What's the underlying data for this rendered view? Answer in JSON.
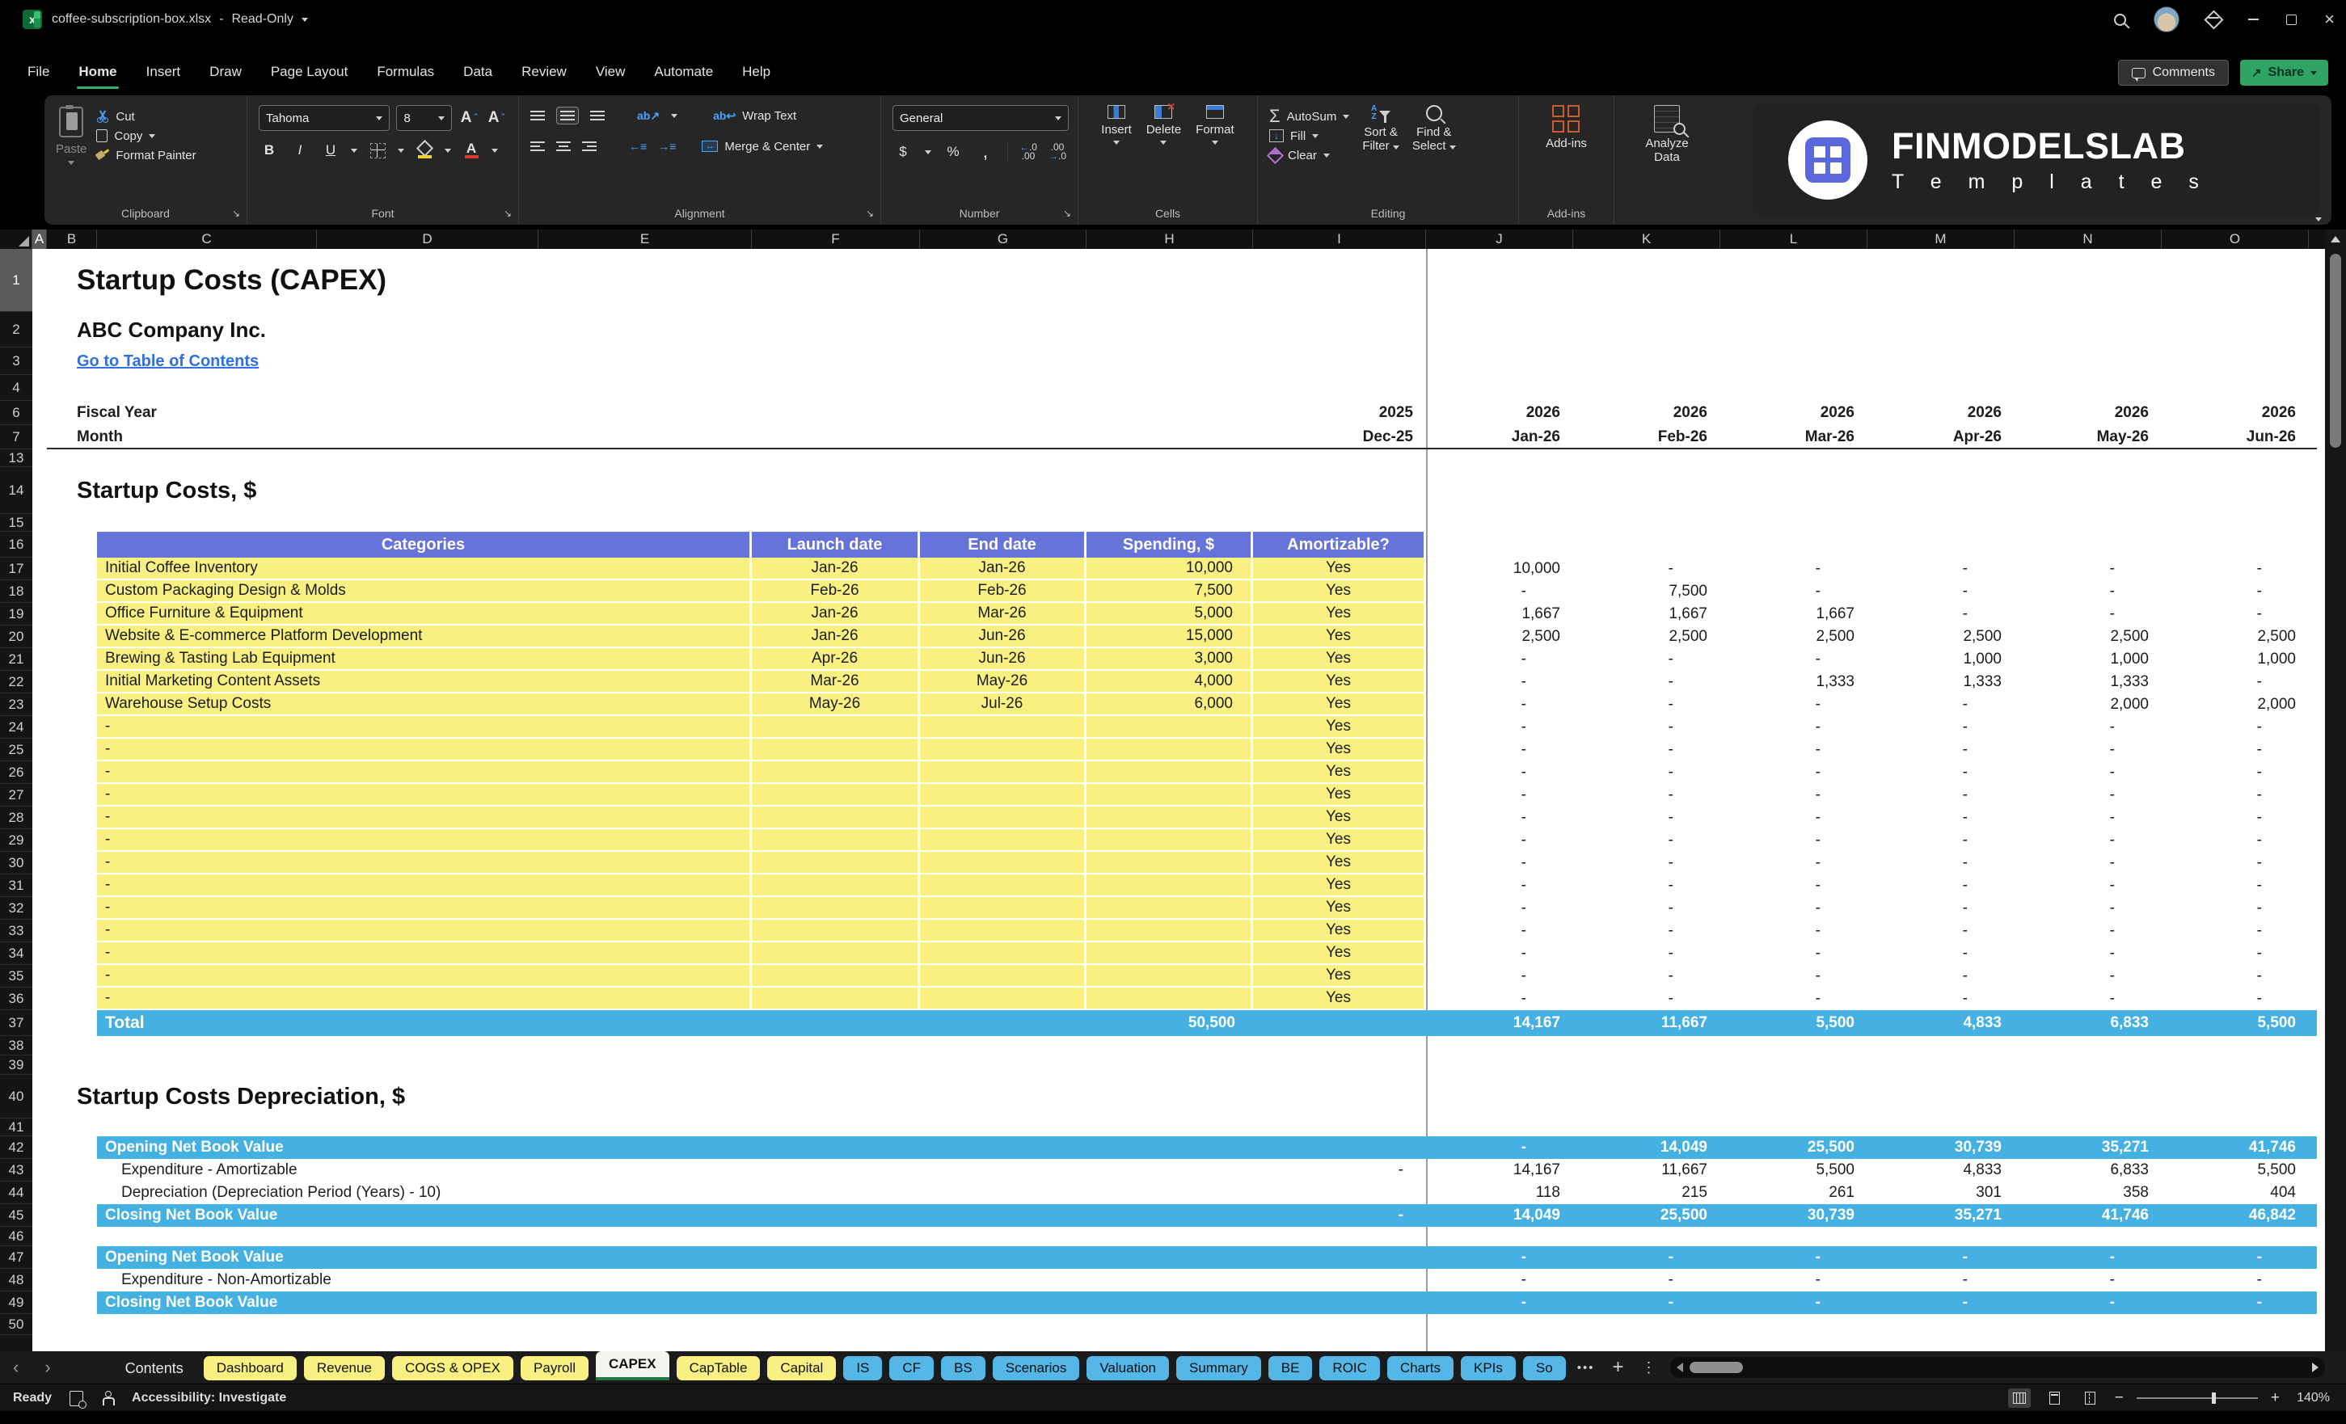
{
  "titlebar": {
    "filename": "coffee-subscription-box.xlsx",
    "separator": "-",
    "mode": "Read-Only"
  },
  "menu": {
    "items": [
      "File",
      "Home",
      "Insert",
      "Draw",
      "Page Layout",
      "Formulas",
      "Data",
      "Review",
      "View",
      "Automate",
      "Help"
    ],
    "active": "Home",
    "comments": "Comments",
    "share": "Share"
  },
  "ribbon": {
    "paste": "Paste",
    "cut": "Cut",
    "copy": "Copy",
    "format_painter": "Format Painter",
    "clipboard_group": "Clipboard",
    "font_name": "Tahoma",
    "font_size": "8",
    "font_group": "Font",
    "wrap_text": "Wrap Text",
    "merge_center": "Merge & Center",
    "alignment_group": "Alignment",
    "number_format": "General",
    "number_group": "Number",
    "insert": "Insert",
    "delete": "Delete",
    "format": "Format",
    "cells_group": "Cells",
    "autosum": "AutoSum",
    "fill": "Fill",
    "clear": "Clear",
    "sort_l1": "Sort &",
    "sort_l2": "Filter",
    "find_l1": "Find &",
    "find_l2": "Select",
    "editing_group": "Editing",
    "addins": "Add-ins",
    "addins_group": "Add-ins",
    "analyze_l1": "Analyze",
    "analyze_l2": "Data",
    "brand": "FINMODELSLAB",
    "brand_sub": "T e m p l a t e s"
  },
  "grid": {
    "columns": [
      "A",
      "B",
      "C",
      "D",
      "E",
      "F",
      "G",
      "H",
      "I",
      "J",
      "K",
      "L",
      "M",
      "N",
      "O"
    ],
    "row_numbers": [
      1,
      2,
      3,
      4,
      6,
      7,
      13,
      14,
      15,
      16,
      17,
      18,
      19,
      20,
      21,
      22,
      23,
      24,
      25,
      26,
      27,
      28,
      29,
      30,
      31,
      32,
      33,
      34,
      35,
      36,
      37,
      38,
      39,
      40,
      41,
      42,
      43,
      44,
      45,
      46,
      47,
      48,
      49,
      50
    ],
    "title": "Startup Costs (CAPEX)",
    "company": "ABC Company Inc.",
    "link": "Go to Table of Contents",
    "fiscal": {
      "label": "Fiscal Year",
      "dec": "2025",
      "months": [
        "2026",
        "2026",
        "2026",
        "2026",
        "2026",
        "2026"
      ]
    },
    "month": {
      "label": "Month",
      "dec": "Dec-25",
      "months": [
        "Jan-26",
        "Feb-26",
        "Mar-26",
        "Apr-26",
        "May-26",
        "Jun-26"
      ]
    },
    "section1": "Startup Costs, $",
    "table": {
      "headers": [
        "Categories",
        "Launch date",
        "End date",
        "Spending, $",
        "Amortizable?"
      ],
      "rows": [
        {
          "category": "Initial Coffee Inventory",
          "launch": "Jan-26",
          "end": "Jan-26",
          "spending": "10,000",
          "amortizable": "Yes",
          "monthly": [
            "10,000",
            "-",
            "-",
            "-",
            "-",
            "-"
          ]
        },
        {
          "category": "Custom Packaging Design & Molds",
          "launch": "Feb-26",
          "end": "Feb-26",
          "spending": "7,500",
          "amortizable": "Yes",
          "monthly": [
            "-",
            "7,500",
            "-",
            "-",
            "-",
            "-"
          ]
        },
        {
          "category": "Office Furniture & Equipment",
          "launch": "Jan-26",
          "end": "Mar-26",
          "spending": "5,000",
          "amortizable": "Yes",
          "monthly": [
            "1,667",
            "1,667",
            "1,667",
            "-",
            "-",
            "-"
          ]
        },
        {
          "category": "Website & E-commerce Platform Development",
          "launch": "Jan-26",
          "end": "Jun-26",
          "spending": "15,000",
          "amortizable": "Yes",
          "monthly": [
            "2,500",
            "2,500",
            "2,500",
            "2,500",
            "2,500",
            "2,500"
          ]
        },
        {
          "category": "Brewing & Tasting Lab Equipment",
          "launch": "Apr-26",
          "end": "Jun-26",
          "spending": "3,000",
          "amortizable": "Yes",
          "monthly": [
            "-",
            "-",
            "-",
            "1,000",
            "1,000",
            "1,000"
          ]
        },
        {
          "category": "Initial Marketing Content Assets",
          "launch": "Mar-26",
          "end": "May-26",
          "spending": "4,000",
          "amortizable": "Yes",
          "monthly": [
            "-",
            "-",
            "1,333",
            "1,333",
            "1,333",
            "-"
          ]
        },
        {
          "category": "Warehouse Setup Costs",
          "launch": "May-26",
          "end": "Jul-26",
          "spending": "6,000",
          "amortizable": "Yes",
          "monthly": [
            "-",
            "-",
            "-",
            "-",
            "2,000",
            "2,000"
          ]
        }
      ],
      "empty_row": {
        "category": "-",
        "amortizable": "Yes",
        "monthly": [
          "-",
          "-",
          "-",
          "-",
          "-",
          "-"
        ]
      },
      "total": {
        "label": "Total",
        "spending": "50,500",
        "monthly": [
          "14,167",
          "11,667",
          "5,500",
          "4,833",
          "6,833",
          "5,500"
        ]
      }
    },
    "section2": "Startup Costs Depreciation, $",
    "depreciation": [
      {
        "label": "Opening Net Book Value",
        "style": "band",
        "dec": "",
        "monthly": [
          "-",
          "14,049",
          "25,500",
          "30,739",
          "35,271",
          "41,746"
        ]
      },
      {
        "label": "Expenditure - Amortizable",
        "style": "plain",
        "dec": "-",
        "monthly": [
          "14,167",
          "11,667",
          "5,500",
          "4,833",
          "6,833",
          "5,500"
        ]
      },
      {
        "label": "Depreciation (Depreciation Period (Years) - 10)",
        "style": "plain",
        "dec": "",
        "monthly": [
          "118",
          "215",
          "261",
          "301",
          "358",
          "404"
        ]
      },
      {
        "label": "Closing Net Book Value",
        "style": "band",
        "dec": "-",
        "monthly": [
          "14,049",
          "25,500",
          "30,739",
          "35,271",
          "41,746",
          "46,842"
        ]
      }
    ],
    "nbv2": [
      {
        "label": "Opening Net Book Value",
        "style": "band",
        "dec": "",
        "monthly": [
          "-",
          "-",
          "-",
          "-",
          "-",
          "-"
        ]
      },
      {
        "label": "Expenditure - Non-Amortizable",
        "style": "plain",
        "dec": "",
        "monthly": [
          "-",
          "-",
          "-",
          "-",
          "-",
          "-"
        ]
      },
      {
        "label": "Closing Net Book Value",
        "style": "band",
        "dec": "",
        "monthly": [
          "-",
          "-",
          "-",
          "-",
          "-",
          "-"
        ]
      }
    ]
  },
  "sheetbar": {
    "tabs": [
      {
        "label": "Contents",
        "color": "plain"
      },
      {
        "label": "Dashboard",
        "color": "yellow"
      },
      {
        "label": "Revenue",
        "color": "yellow"
      },
      {
        "label": "COGS & OPEX",
        "color": "yellow"
      },
      {
        "label": "Payroll",
        "color": "yellow"
      },
      {
        "label": "CAPEX",
        "color": "active"
      },
      {
        "label": "CapTable",
        "color": "yellow"
      },
      {
        "label": "Capital",
        "color": "yellow"
      },
      {
        "label": "IS",
        "color": "blue"
      },
      {
        "label": "CF",
        "color": "blue"
      },
      {
        "label": "BS",
        "color": "blue"
      },
      {
        "label": "Scenarios",
        "color": "blue"
      },
      {
        "label": "Valuation",
        "color": "blue"
      },
      {
        "label": "Summary",
        "color": "blue"
      },
      {
        "label": "BE",
        "color": "blue"
      },
      {
        "label": "ROIC",
        "color": "blue"
      },
      {
        "label": "Charts",
        "color": "blue"
      },
      {
        "label": "KPIs",
        "color": "blue"
      },
      {
        "label": "So",
        "color": "blue cut"
      }
    ]
  },
  "statusbar": {
    "ready": "Ready",
    "accessibility": "Accessibility: Investigate",
    "zoom": "140%"
  },
  "colors": {
    "accent_green": "#35b26a",
    "table_header": "#6673d8",
    "highlight_yellow": "#f8f182",
    "band_blue": "#45b0e2",
    "tab_blue": "#55b7e8",
    "link_blue": "#2e6fe4",
    "addins_orange": "#cc5b2e",
    "logo_purple": "#5b67dd"
  }
}
